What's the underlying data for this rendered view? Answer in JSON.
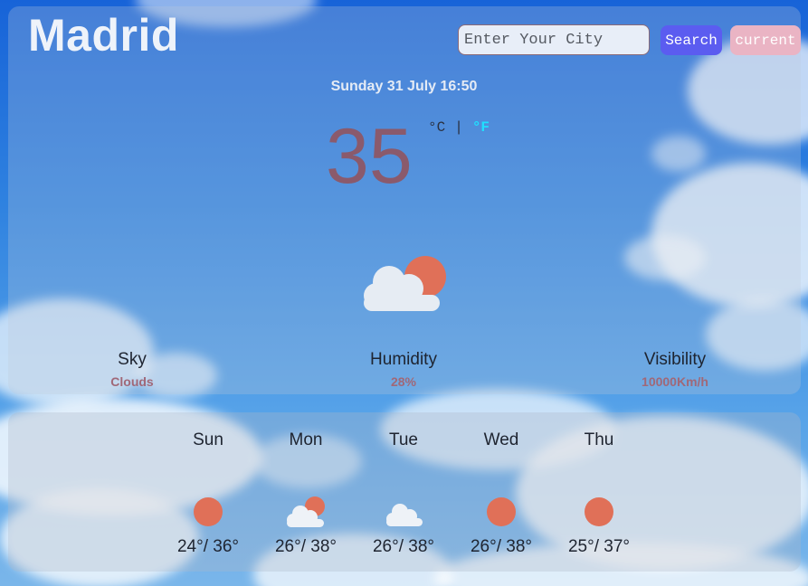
{
  "city": "Madrid",
  "search": {
    "placeholder": "Enter Your City",
    "search_label": "Search",
    "current_label": "current"
  },
  "date_time": "Sunday 31 July 16:50",
  "temperature": {
    "value": "35",
    "unit_c": "°C",
    "separator": "|",
    "unit_f": "°F"
  },
  "main_icon": "sun-behind-cloud-icon",
  "stats": {
    "sky": {
      "label": "Sky",
      "value": "Clouds"
    },
    "humidity": {
      "label": "Humidity",
      "value": "28%"
    },
    "visibility": {
      "label": "Visibility",
      "value": "10000Km/h"
    }
  },
  "forecast": [
    {
      "day": "Sun",
      "icon": "sun-icon",
      "temps": "24°/ 36°"
    },
    {
      "day": "Mon",
      "icon": "sun-behind-cloud-icon",
      "temps": "26°/ 38°"
    },
    {
      "day": "Tue",
      "icon": "cloud-icon",
      "temps": "26°/ 38°"
    },
    {
      "day": "Wed",
      "icon": "sun-icon",
      "temps": "26°/ 38°"
    },
    {
      "day": "Thu",
      "icon": "sun-icon",
      "temps": "25°/ 37°"
    }
  ],
  "colors": {
    "search_button": "#5b5cf0",
    "current_button": "#eab4c4",
    "temperature": "#8a5a6c",
    "active_unit": "#1fe0ff",
    "sun": "#e07058"
  }
}
